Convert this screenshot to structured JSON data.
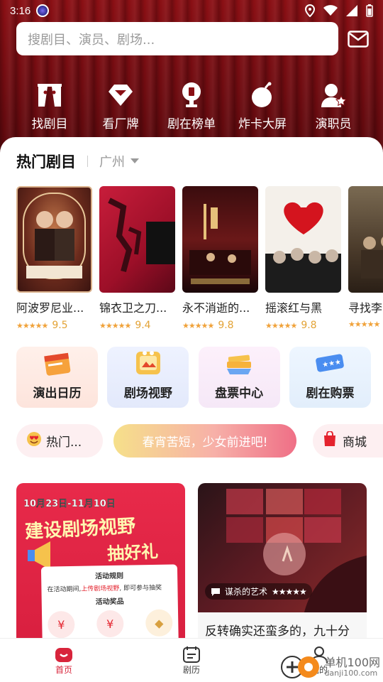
{
  "status_bar": {
    "time": "3:16"
  },
  "search": {
    "placeholder": "搜剧目、演员、剧场..."
  },
  "quick_nav": [
    {
      "label": "找剧目",
      "icon": "theater-icon"
    },
    {
      "label": "看厂牌",
      "icon": "brand-gem-icon"
    },
    {
      "label": "剧在榜单",
      "icon": "trophy-icon"
    },
    {
      "label": "炸卡大屏",
      "icon": "bomb-icon"
    },
    {
      "label": "演职员",
      "icon": "performer-icon"
    }
  ],
  "hot_section": {
    "title": "热门剧目",
    "city": "广州"
  },
  "shows": [
    {
      "name": "阿波罗尼业...",
      "rating": "9.5"
    },
    {
      "name": "锦衣卫之刀...",
      "rating": "9.4"
    },
    {
      "name": "永不消逝的...",
      "rating": "9.8"
    },
    {
      "name": "摇滚红与黑",
      "rating": "9.8"
    },
    {
      "name": "寻找李",
      "rating": ""
    }
  ],
  "features": [
    {
      "label": "演出日历",
      "icon": "calendar-icon"
    },
    {
      "label": "剧场视野",
      "icon": "theater-view-icon"
    },
    {
      "label": "盘票中心",
      "icon": "ticket-stack-icon"
    },
    {
      "label": "剧在购票",
      "icon": "ticket-icon"
    }
  ],
  "pills": {
    "hot": "热门...",
    "banner": "春宵苦短，少女前进吧!",
    "shop": "商城"
  },
  "feed": {
    "promo": {
      "date": "10月23日-11月10日",
      "headline1": "建设剧场视野",
      "headline2": "抽好礼",
      "rules_title": "活动规则",
      "rules_text_a": "在活动期间,",
      "rules_text_b": "上传剧场视野",
      "rules_text_c": ", 即可参与抽奖",
      "prize_title": "活动奖品"
    },
    "post": {
      "author": "谋杀的艺术",
      "stars": "★★★★★",
      "text": "反转确实还蛮多的，九十分"
    }
  },
  "bottom_nav": [
    {
      "label": "首页",
      "icon": "home-icon"
    },
    {
      "label": "剧历",
      "icon": "calendar-list-icon"
    },
    {
      "label": "我的",
      "icon": "profile-icon"
    }
  ],
  "watermark": {
    "name": "单机100网",
    "url": "danji100.com"
  }
}
